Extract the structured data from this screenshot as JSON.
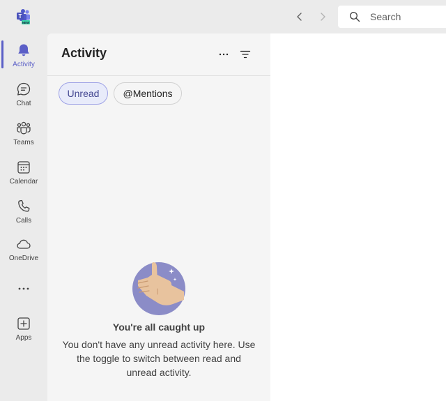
{
  "app": {
    "logo_icon": "teams-new-logo-icon",
    "logo_badge": "NEW"
  },
  "topbar": {
    "back_icon": "chevron-left-icon",
    "forward_icon": "chevron-right-icon",
    "search_placeholder": "Search"
  },
  "rail": {
    "items": [
      {
        "label": "Activity",
        "icon": "bell-icon",
        "active": true
      },
      {
        "label": "Chat",
        "icon": "chat-icon"
      },
      {
        "label": "Teams",
        "icon": "teams-icon"
      },
      {
        "label": "Calendar",
        "icon": "calendar-icon"
      },
      {
        "label": "Calls",
        "icon": "phone-icon"
      },
      {
        "label": "OneDrive",
        "icon": "cloud-icon"
      },
      {
        "label": "",
        "icon": "more-horizontal-icon"
      },
      {
        "label": "Apps",
        "icon": "add-app-icon"
      }
    ]
  },
  "activity": {
    "title": "Activity",
    "more_icon": "more-horizontal-icon",
    "filter_icon": "filter-icon",
    "chips": [
      "Unread",
      "@Mentions"
    ],
    "empty_title": "You're all caught up",
    "empty_desc": "You don't have any unread activity here. Use the toggle to switch between read and unread activity."
  },
  "colors": {
    "accent": "#5b5fc7",
    "chip_active_bg": "#e8ebfa",
    "illustration": "#8b8cc7"
  }
}
